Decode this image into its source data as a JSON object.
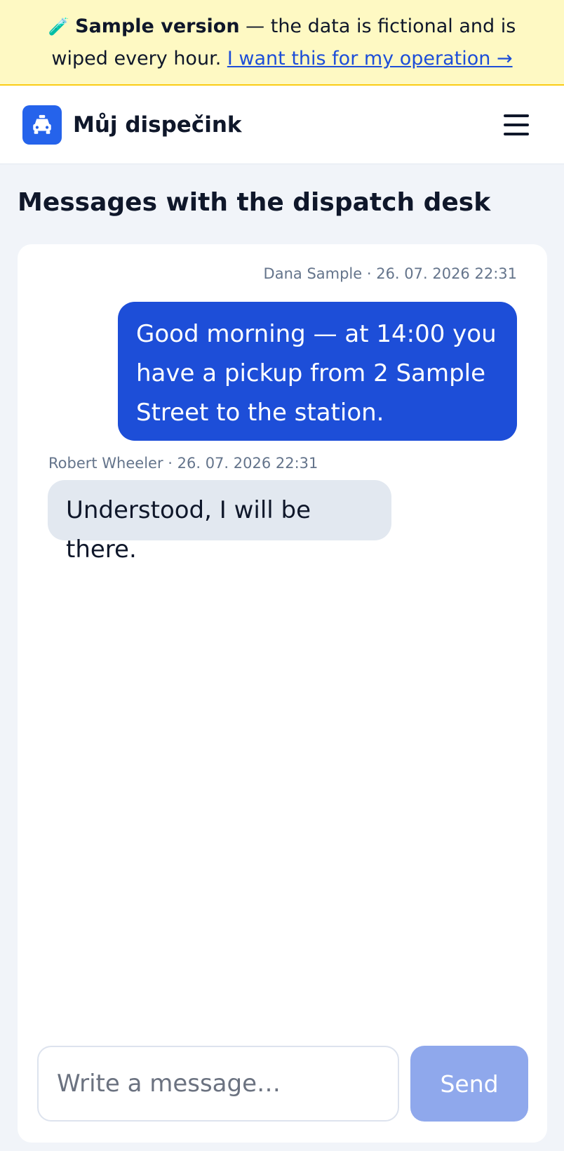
{
  "banner": {
    "emoji": "🧪",
    "bold": "Sample version",
    "text": " — the data is fictional and is wiped every hour. ",
    "link": "I want this for my operation →"
  },
  "header": {
    "logo_icon": "taxi-icon",
    "title": "Můj dispečink",
    "menu_icon": "hamburger-menu-icon"
  },
  "page": {
    "title": "Messages with the dispatch desk"
  },
  "messages": [
    {
      "direction": "outgoing",
      "meta": "Dana Sample · 26. 07. 2026 22:31",
      "text": "Good morning — at 14:00 you have a pickup from 2 Sample Street to the station."
    },
    {
      "direction": "incoming",
      "meta": "Robert Wheeler · 26. 07. 2026 22:31",
      "text": "Understood, I will be there."
    }
  ],
  "composer": {
    "placeholder": "Write a message…",
    "send_label": "Send"
  },
  "colors": {
    "accent": "#1d4ed8",
    "banner_bg": "#fef9c3",
    "send_disabled": "#8fa8ec"
  }
}
